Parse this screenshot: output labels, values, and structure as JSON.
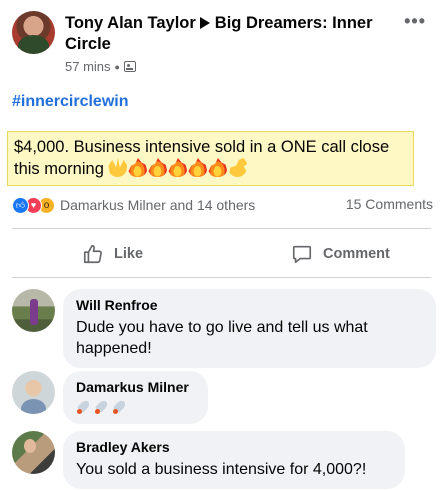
{
  "post": {
    "author": "Tony Alan Taylor",
    "group": "Big Dreamers: Inner Circle",
    "time": "57 mins",
    "hashtag": "#innercirclewin",
    "body_text": "$4,000. Business intensive sold in a ONE call close this morning",
    "body_emojis": [
      "raising-hands-emoji",
      "fire-emoji",
      "fire-emoji",
      "fire-emoji",
      "fire-emoji",
      "fire-emoji",
      "flexed-biceps-emoji"
    ]
  },
  "reactions": {
    "icons": [
      "like-reaction-icon",
      "love-reaction-icon",
      "wow-reaction-icon"
    ],
    "names": "Damarkus Milner and 14 others",
    "comments_count": "15 Comments"
  },
  "actions": {
    "like_label": "Like",
    "comment_label": "Comment"
  },
  "comments": [
    {
      "name": "Will Renfroe",
      "text": "Dude you have to go live and tell us what happened!"
    },
    {
      "name": "Damarkus Milner",
      "text": "",
      "emojis": [
        "rocket-emoji",
        "rocket-emoji",
        "rocket-emoji"
      ]
    },
    {
      "name": "Bradley Akers",
      "text": "You sold a business intensive for 4,000?!"
    }
  ],
  "colors": {
    "hashtag": "#216fdb",
    "highlight_bg": "#fdf8c4",
    "highlight_border": "#e8d95a",
    "secondary_text": "#65676b",
    "bubble_bg": "#f0f2f5"
  }
}
